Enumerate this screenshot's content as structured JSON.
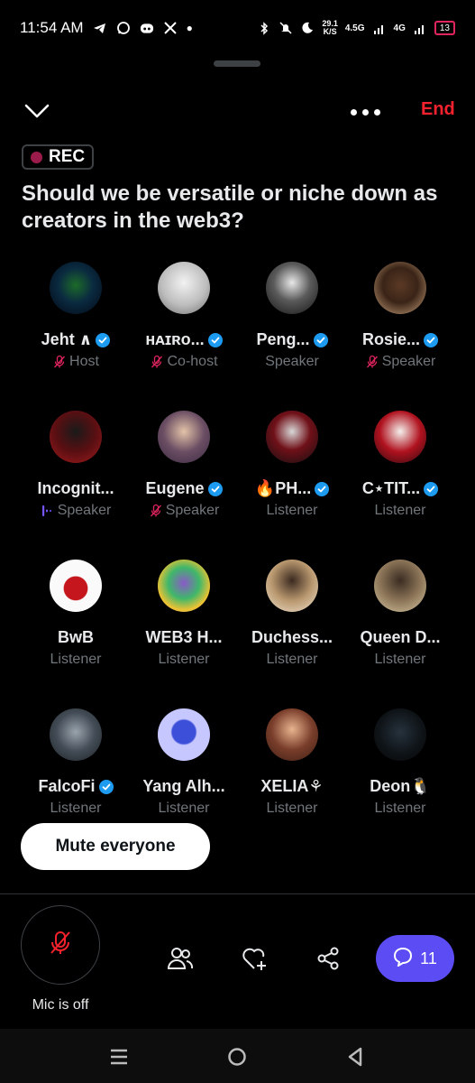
{
  "status_bar": {
    "time": "11:54 AM",
    "net_speed_value": "29.1",
    "net_speed_unit": "K/S",
    "signal_1": "4.5G",
    "signal_2": "4G",
    "battery": "13"
  },
  "top_bar": {
    "end_label": "End"
  },
  "rec_label": "REC",
  "space_title": "Should we be versatile or niche down as creators in the web3?",
  "participants": [
    {
      "name": "Jeht ∧",
      "role": "Host",
      "verified": true,
      "mic_off": true
    },
    {
      "name": "ʜᴀɪʀᴏ...",
      "role": "Co-host",
      "verified": true,
      "mic_off": true
    },
    {
      "name": "Peng...",
      "role": "Speaker",
      "verified": true,
      "mic_off": false
    },
    {
      "name": "Rosie...",
      "role": "Speaker",
      "verified": true,
      "mic_off": true
    },
    {
      "name": "Incognit...",
      "role": "Speaker",
      "verified": false,
      "mic_off": false,
      "speaking": true
    },
    {
      "name": "Eugene",
      "role": "Speaker",
      "verified": true,
      "mic_off": true
    },
    {
      "name": "🔥PH...",
      "role": "Listener",
      "verified": true,
      "mic_off": false
    },
    {
      "name": "C⋆TIT...",
      "role": "Listener",
      "verified": true,
      "mic_off": false
    },
    {
      "name": "BwB",
      "role": "Listener",
      "verified": false,
      "mic_off": false
    },
    {
      "name": "WEB3 H...",
      "role": "Listener",
      "verified": false,
      "mic_off": false
    },
    {
      "name": "Duchess...",
      "role": "Listener",
      "verified": false,
      "mic_off": false
    },
    {
      "name": "Queen D...",
      "role": "Listener",
      "verified": false,
      "mic_off": false
    },
    {
      "name": "FalcoFi",
      "role": "Listener",
      "verified": true,
      "mic_off": false
    },
    {
      "name": "Yang Alh...",
      "role": "Listener",
      "verified": false,
      "mic_off": false
    },
    {
      "name": "XELIA⚘",
      "role": "Listener",
      "verified": false,
      "mic_off": false
    },
    {
      "name": "Deon🐧",
      "role": "Listener",
      "verified": false,
      "mic_off": false
    }
  ],
  "mute_everyone_label": "Mute everyone",
  "mic_label": "Mic is off",
  "comment_count": "11",
  "colors": {
    "accent_red": "#f4212e",
    "verified_blue": "#1d9bf0",
    "comment_purple": "#5c4cf4",
    "muted_pink": "#e0245e"
  },
  "icons": [
    "telegram-icon",
    "whatsapp-icon",
    "discord-icon",
    "x-icon",
    "bluetooth-icon",
    "mute-icon",
    "moon-icon",
    "chevron-down-icon",
    "more-icon",
    "people-icon",
    "heart-plus-icon",
    "share-icon",
    "comment-icon",
    "menu-icon",
    "home-icon",
    "back-icon"
  ]
}
